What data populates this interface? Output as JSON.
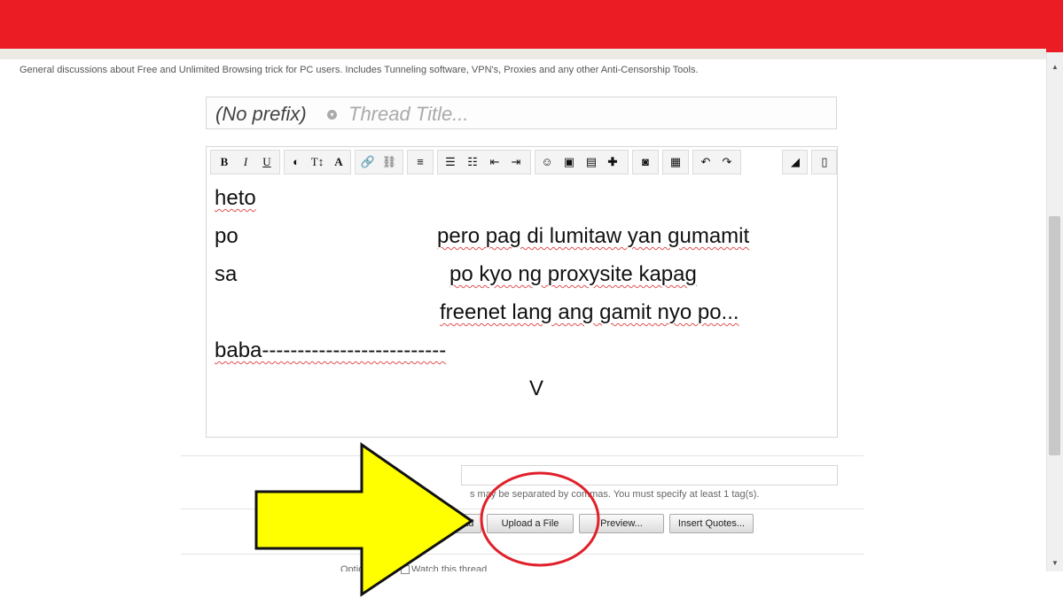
{
  "forum": {
    "description": "General discussions about Free and Unlimited Browsing trick for PC users. Includes Tunneling software, VPN's, Proxies and any other Anti-Censorship Tools."
  },
  "thread_form": {
    "prefix": "(No prefix)",
    "title_placeholder": "Thread Title..."
  },
  "editor": {
    "lines": [
      [
        "heto",
        ""
      ],
      [
        "po",
        "pero pag di lumitaw yan gumamit"
      ],
      [
        "sa",
        "po kyo ng proxysite kapag"
      ],
      [
        "",
        "freenet lang ang gamit nyo po..."
      ],
      [
        "baba--------------------------",
        ""
      ],
      [
        "",
        "V"
      ]
    ],
    "toolbar_icons": [
      "bold-icon",
      "italic-icon",
      "underline-icon",
      "text-color-icon",
      "font-size-icon",
      "font-family-icon",
      "link-icon",
      "unlink-icon",
      "align-icon",
      "bullet-list-icon",
      "numbered-list-icon",
      "outdent-icon",
      "indent-icon",
      "smilie-icon",
      "image-icon",
      "media-icon",
      "insert-icon",
      "screenshot-icon",
      "save-draft-icon",
      "undo-icon",
      "redo-icon",
      "remove-formatting-icon",
      "view-source-icon"
    ]
  },
  "tags": {
    "help_text": "s may be separated by commas. You must specify at least 1 tag(s)."
  },
  "buttons": {
    "create_thread": "Create Thread",
    "upload_file": "Upload a File",
    "preview": "Preview...",
    "insert_quotes": "Insert Quotes..."
  },
  "options": {
    "label": "Options",
    "watch": "Watch this thread"
  },
  "colors": {
    "header_red": "#ec1c24",
    "arrow_yellow": "#ffff00",
    "circle_red": "#e0202a"
  }
}
